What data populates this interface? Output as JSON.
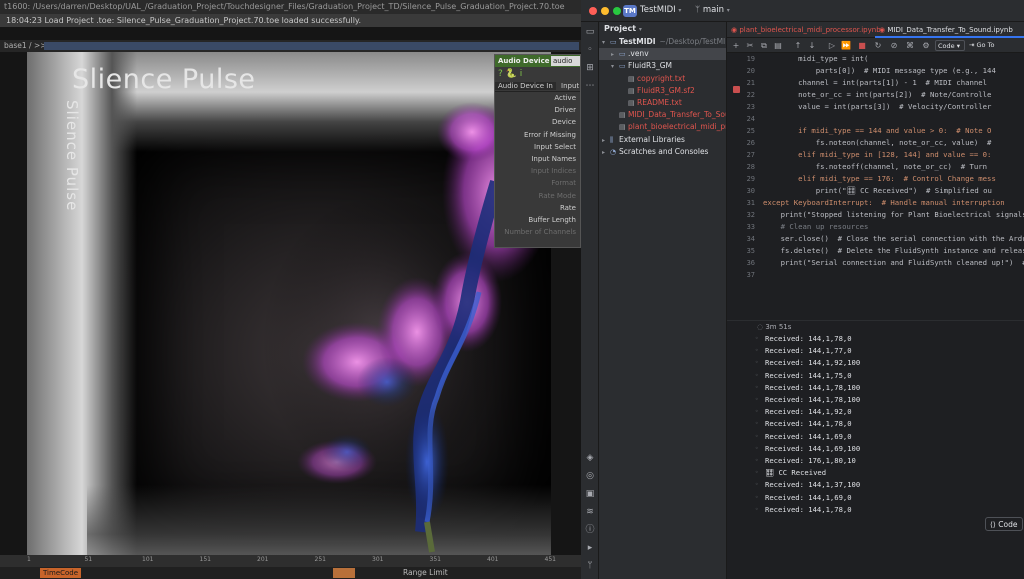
{
  "touchdesigner": {
    "title_path": "t1600: /Users/darren/Desktop/UAL_/Graduation_Project/Touchdesigner_Files/Graduation_Project_TD/Silence_Pulse_Graduation_Project.70.toe",
    "status_message": "18:04:23 Load Project .toe: Silence_Pulse_Graduation_Project.70.toe loaded successfully.",
    "path_bar": "base1 / >>",
    "viewer_title": "Slience Pulse",
    "viewer_vertical_title": "Slience Pulse",
    "param_panel": {
      "header": "Audio Device In",
      "header_tag": "audio",
      "tabs": [
        "Audio Device In",
        "Input"
      ],
      "params": [
        {
          "label": "Active",
          "enabled": true
        },
        {
          "label": "Driver",
          "enabled": true
        },
        {
          "label": "Device",
          "enabled": true
        },
        {
          "label": "Error if Missing",
          "enabled": true
        },
        {
          "label": "Input Select",
          "enabled": true
        },
        {
          "label": "Input Names",
          "enabled": true
        },
        {
          "label": "Input Indices",
          "enabled": false
        },
        {
          "label": "Format",
          "enabled": false
        },
        {
          "label": "Rate Mode",
          "enabled": false
        },
        {
          "label": "Rate",
          "enabled": true
        },
        {
          "label": "Buffer Length",
          "enabled": true
        },
        {
          "label": "Number of Channels",
          "enabled": false
        }
      ]
    },
    "timeline_ticks": [
      "1",
      "51",
      "101",
      "151",
      "201",
      "251",
      "301",
      "351",
      "401",
      "451"
    ],
    "timecode_label": "TimeCode",
    "range_label": "Range Limit"
  },
  "pycharm": {
    "project_badge": "TM",
    "project_name": "TestMIDI",
    "branch": "main",
    "project_panel_title": "Project",
    "tree": [
      {
        "label": "TestMIDI",
        "suffix": "~/Desktop/TestMIDI",
        "depth": 0,
        "type": "folder",
        "expanded": true,
        "selected": false
      },
      {
        "label": ".venv",
        "depth": 1,
        "type": "folder",
        "expanded": false,
        "selected": true
      },
      {
        "label": "FluidR3_GM",
        "depth": 1,
        "type": "folder",
        "expanded": true,
        "selected": false
      },
      {
        "label": "copyright.txt",
        "depth": 2,
        "type": "file",
        "selected": false
      },
      {
        "label": "FluidR3_GM.sf2",
        "depth": 2,
        "type": "file",
        "selected": false
      },
      {
        "label": "README.txt",
        "depth": 2,
        "type": "file",
        "selected": false
      },
      {
        "label": "MIDI_Data_Transfer_To_Sound.ipynb",
        "depth": 1,
        "type": "file",
        "selected": false
      },
      {
        "label": "plant_bioelectrical_midi_processor.ipynb",
        "depth": 1,
        "type": "file",
        "selected": false
      },
      {
        "label": "External Libraries",
        "depth": 0,
        "type": "lib",
        "expanded": false,
        "selected": false
      },
      {
        "label": "Scratches and Consoles",
        "depth": 0,
        "type": "scratch",
        "expanded": false,
        "selected": false
      }
    ],
    "editor_tabs": [
      {
        "label": "plant_bioelectrical_midi_processor.ipynb",
        "active": false
      },
      {
        "label": "MIDI_Data_Transfer_To_Sound.ipynb",
        "active": true
      }
    ],
    "toolbar": {
      "code_select": "Code",
      "goto_label": "Go To"
    },
    "line_numbers": [
      "19",
      "20",
      "21",
      "22",
      "23",
      "24",
      "25",
      "26",
      "27",
      "28",
      "29",
      "30",
      "31",
      "32",
      "33",
      "34",
      "35",
      "36",
      "37"
    ],
    "code_lines": [
      "        midi_type = int(",
      "            parts[0])  # MIDI message type (e.g., 144",
      "        channel = int(parts[1]) - 1  # MIDI channel",
      "        note_or_cc = int(parts[2])  # Note/Controlle",
      "        value = int(parts[3])  # Velocity/Controller",
      "",
      "        if midi_type == 144 and value > 0:  # Note O",
      "            fs.noteon(channel, note_or_cc, value)  #",
      "        elif midi_type in [128, 144] and value == 0:",
      "            fs.noteoff(channel, note_or_cc)  # Turn",
      "        elif midi_type == 176:  # Control Change mess",
      "            print(\"🎛 CC Received\")  # Simplified ou",
      "except KeyboardInterrupt:  # Handle manual interruption",
      "    print(\"Stopped listening for Plant Bioelectrical signals",
      "    # Clean up resources",
      "    ser.close()  # Close the serial connection with the Ardu",
      "    fs.delete()  # Delete the FluidSynth instance and releas",
      "    print(\"Serial connection and FluidSynth cleaned up!\")  #",
      ""
    ],
    "exec_time": "3m 51s",
    "output_lines": [
      "Received: 144,1,78,0",
      "Received: 144,1,77,0",
      "Received: 144,1,92,100",
      "Received: 144,1,75,0",
      "Received: 144,1,78,100",
      "Received: 144,1,78,100",
      "Received: 144,1,92,0",
      "Received: 144,1,78,0",
      "Received: 144,1,69,0",
      "Received: 144,1,69,100",
      "Received: 176,1,80,10",
      "🎛 CC Received",
      "Received: 144,1,37,100",
      "Received: 144,1,69,0",
      "Received: 144,1,78,0"
    ],
    "code_button": "Code"
  },
  "colors": {
    "td_bg": "#151515",
    "td_param_header": "#3f6a2b",
    "pycharm_bg": "#1e1f22",
    "pycharm_panel": "#2b2d30",
    "accent_blue": "#3574f0",
    "notebook_red": "#e0554e",
    "plant_magenta": "#e36cf0"
  }
}
